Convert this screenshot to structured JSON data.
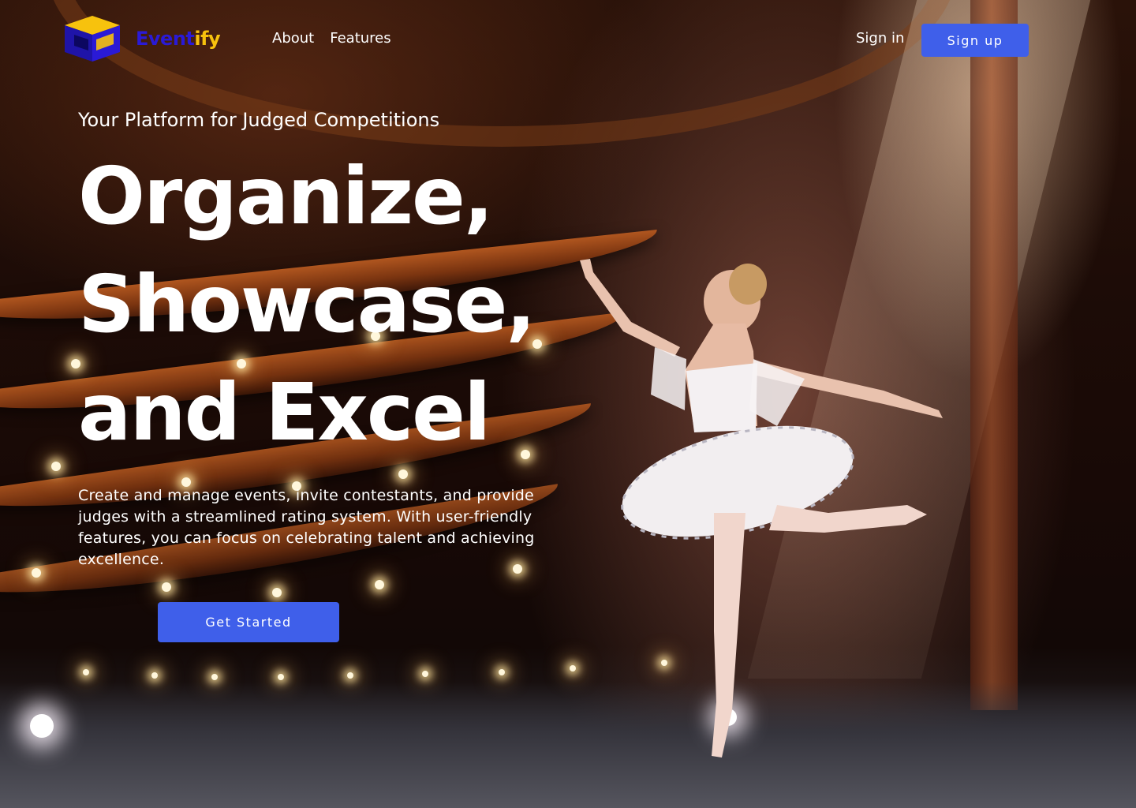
{
  "brand": {
    "name_part1": "Event",
    "name_part2": "ify",
    "logo_icon": "cube-logo-icon",
    "colors": {
      "blue": "#2a1ad6",
      "yellow": "#f7c20d"
    }
  },
  "nav": {
    "links": [
      {
        "label": "About"
      },
      {
        "label": "Features"
      }
    ],
    "signin_label": "Sign in",
    "signup_label": "Sign up"
  },
  "hero": {
    "tagline": "Your Platform for Judged Competitions",
    "headline": [
      "Organize,",
      "Showcase,",
      "and Excel"
    ],
    "description": "Create and manage events, invite contestants, and provide judges with a streamlined rating system. With user-friendly features, you can focus on celebrating talent and achieving excellence.",
    "cta_label": "Get Started",
    "background_image": "ballerina-on-theater-stage-photo"
  },
  "colors": {
    "accent": "#3f5fea",
    "text": "#ffffff"
  }
}
